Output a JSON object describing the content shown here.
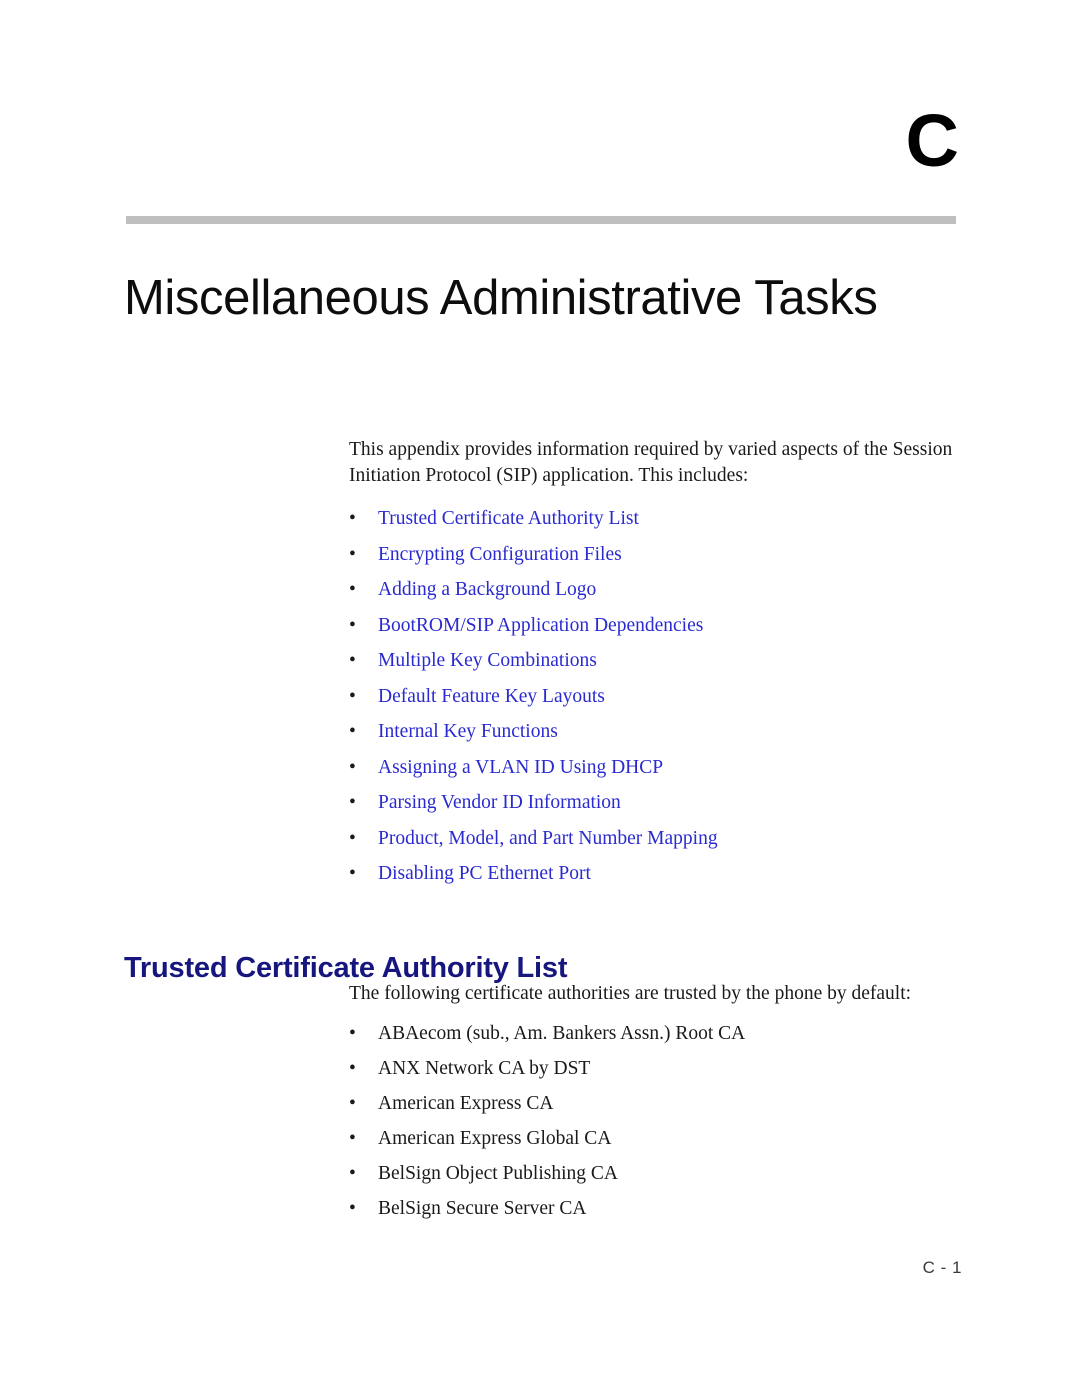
{
  "chapter": {
    "letter": "C",
    "title": "Miscellaneous Administrative Tasks",
    "rule_color": "#bfbfbf"
  },
  "intro": {
    "paragraph": "This appendix provides information required by varied aspects of the Session Initiation Protocol (SIP) application. This includes:"
  },
  "toc": {
    "link_color": "#2a2ad0",
    "bullet_glyph": "•",
    "items": [
      {
        "label": "Trusted Certificate Authority List"
      },
      {
        "label": "Encrypting Configuration Files"
      },
      {
        "label": "Adding a Background Logo"
      },
      {
        "label": "BootROM/SIP Application Dependencies"
      },
      {
        "label": "Multiple Key Combinations"
      },
      {
        "label": "Default Feature Key Layouts"
      },
      {
        "label": "Internal Key Functions"
      },
      {
        "label": "Assigning a VLAN ID Using DHCP"
      },
      {
        "label": "Parsing Vendor ID Information"
      },
      {
        "label": "Product, Model, and Part Number Mapping"
      },
      {
        "label": "Disabling PC Ethernet Port"
      }
    ]
  },
  "section": {
    "heading": "Trusted Certificate Authority List",
    "heading_color": "#16167e",
    "intro": "The following certificate authorities are trusted by the phone by default:",
    "bullet_glyph": "•",
    "authorities": [
      {
        "label": "ABAecom (sub., Am. Bankers Assn.) Root CA"
      },
      {
        "label": "ANX Network CA by DST"
      },
      {
        "label": "American Express CA"
      },
      {
        "label": "American Express Global CA"
      },
      {
        "label": "BelSign Object Publishing CA"
      },
      {
        "label": "BelSign Secure Server CA"
      }
    ]
  },
  "footer": {
    "page_number": "C - 1"
  }
}
